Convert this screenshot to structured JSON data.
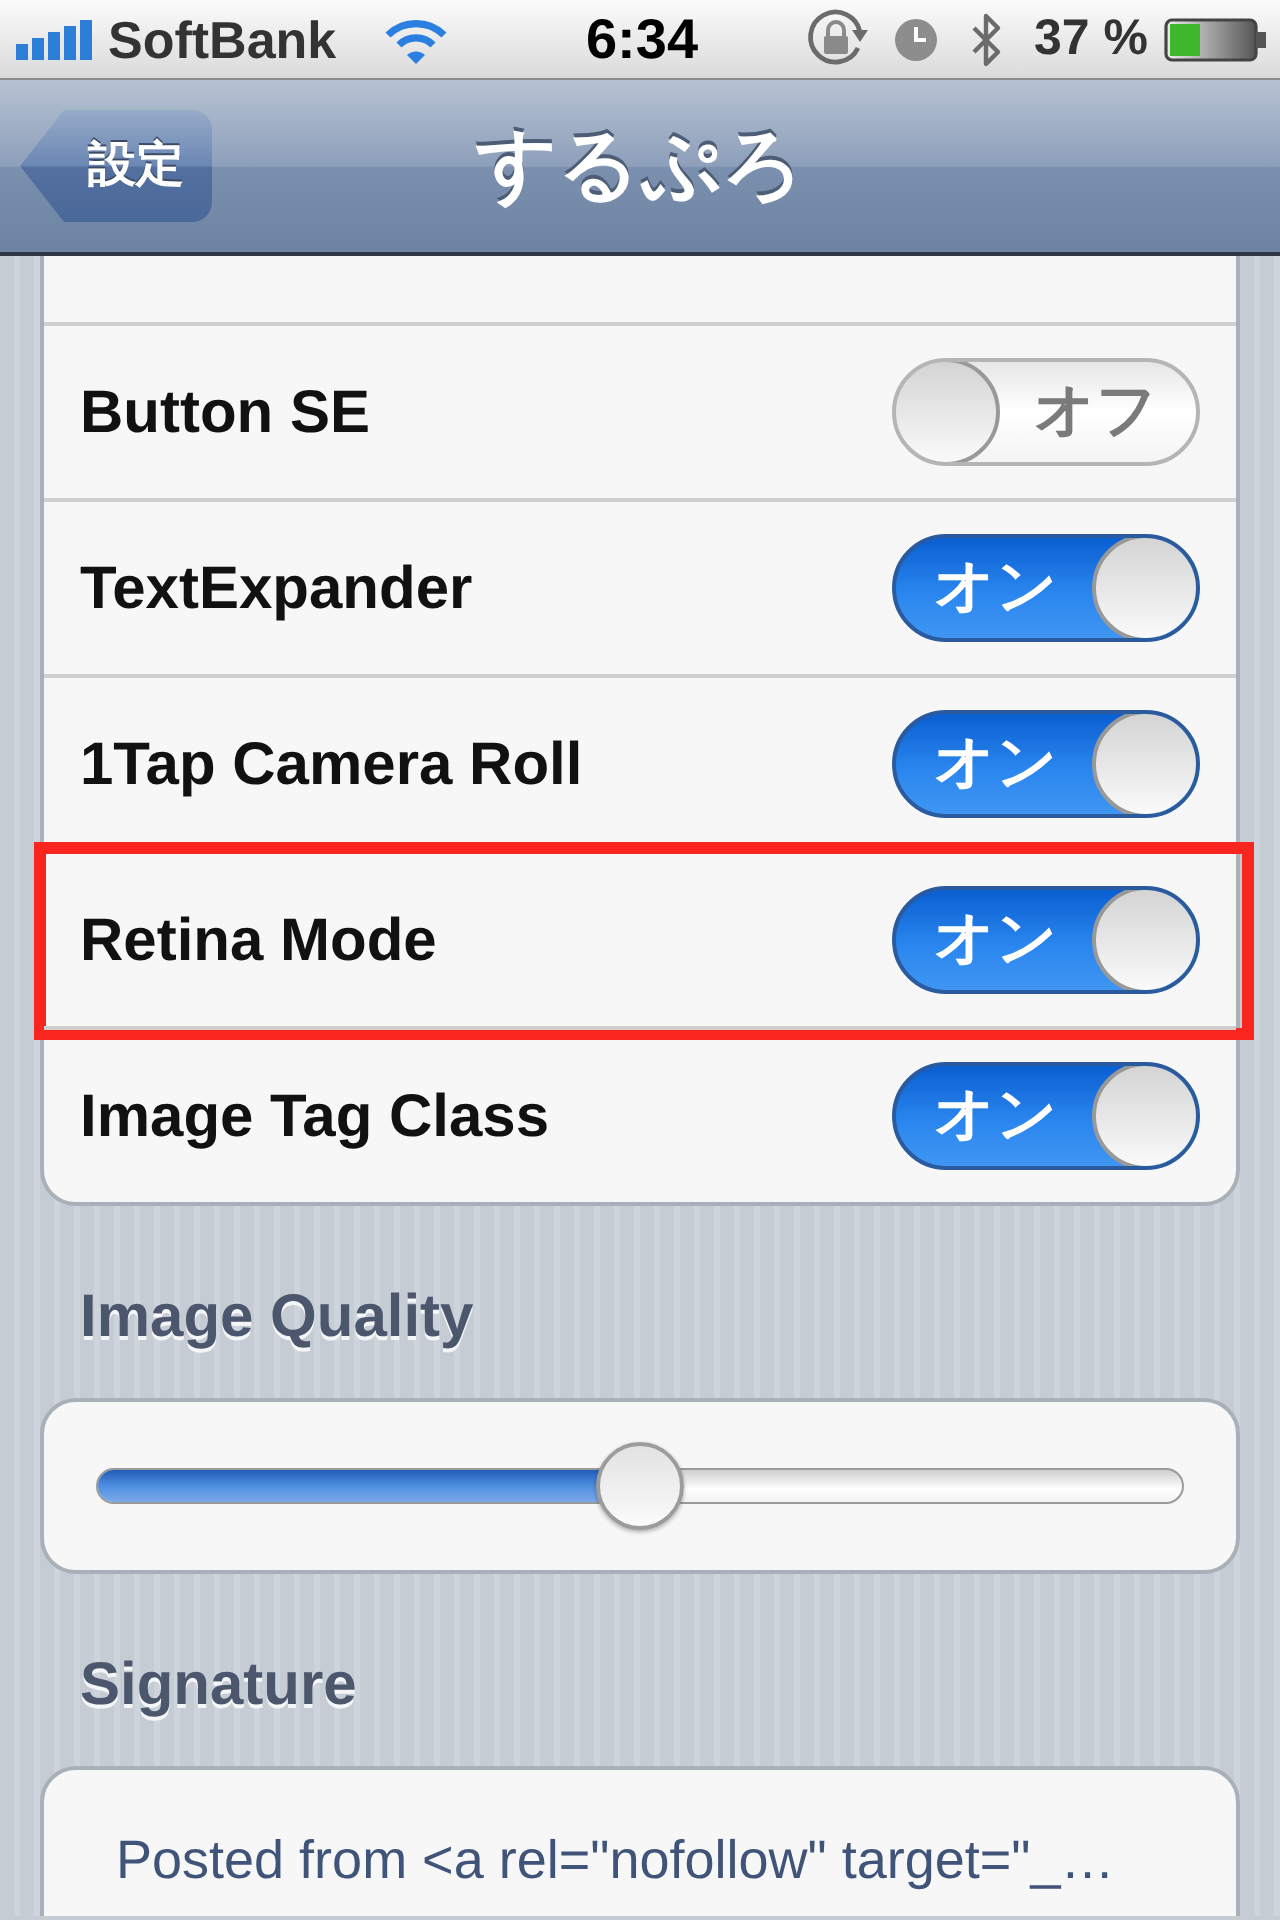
{
  "status_bar": {
    "carrier": "SoftBank",
    "time": "6:34",
    "battery_percent": "37 %"
  },
  "nav_bar": {
    "back_button": "設定",
    "title": "するぷろ"
  },
  "settings": [
    {
      "label": "Button SE",
      "on": false,
      "switch_text": "オフ",
      "highlighted": false
    },
    {
      "label": "TextExpander",
      "on": true,
      "switch_text": "オン",
      "highlighted": false
    },
    {
      "label": "1Tap Camera Roll",
      "on": true,
      "switch_text": "オン",
      "highlighted": false
    },
    {
      "label": "Retina Mode",
      "on": true,
      "switch_text": "オン",
      "highlighted": true
    },
    {
      "label": "Image Tag Class",
      "on": true,
      "switch_text": "オン",
      "highlighted": false
    }
  ],
  "sections": [
    {
      "kind": "slider",
      "header": "Image Quality",
      "level": 0.5
    },
    {
      "kind": "text",
      "header": "Signature",
      "value": "Posted from <a rel=\"nofollow\" target=\"_…"
    }
  ]
}
